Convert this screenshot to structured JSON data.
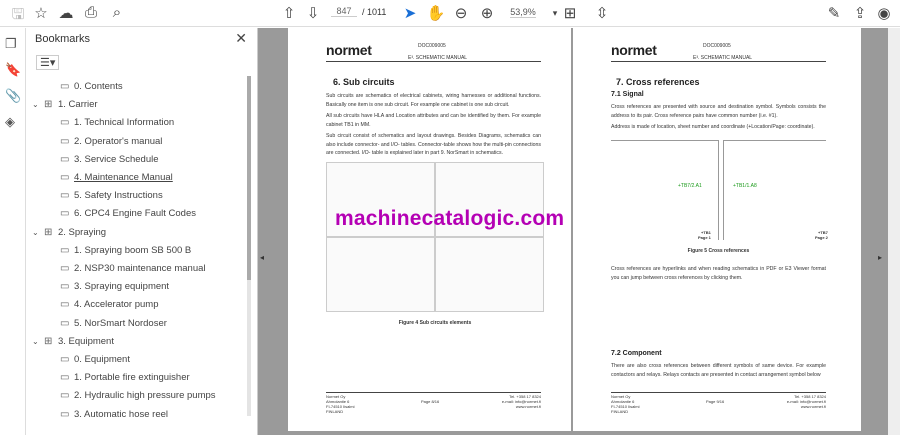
{
  "toolbar": {
    "page_current": "847",
    "page_total": "/ 1011",
    "zoom": "53,9%"
  },
  "bookmarks": {
    "title": "Bookmarks",
    "items": [
      {
        "label": "0. Contents",
        "level": 1,
        "expandable": false
      },
      {
        "label": "1. Carrier",
        "level": 0,
        "expandable": true
      },
      {
        "label": "1. Technical Information",
        "level": 1
      },
      {
        "label": "2. Operator's manual",
        "level": 1
      },
      {
        "label": "3. Service Schedule",
        "level": 1
      },
      {
        "label": "4. Maintenance Manual",
        "level": 1
      },
      {
        "label": "5. Safety Instructions",
        "level": 1
      },
      {
        "label": "6. CPC4 Engine Fault Codes",
        "level": 1
      },
      {
        "label": "2. Spraying",
        "level": 0,
        "expandable": true
      },
      {
        "label": "1. Spraying boom SB 500 B",
        "level": 1
      },
      {
        "label": "2. NSP30 maintenance manual",
        "level": 1
      },
      {
        "label": "3. Spraying equipment",
        "level": 1
      },
      {
        "label": "4. Accelerator pump",
        "level": 1
      },
      {
        "label": "5. NorSmart Nordoser",
        "level": 1
      },
      {
        "label": "3. Equipment",
        "level": 0,
        "expandable": true
      },
      {
        "label": "0. Equipment",
        "level": 1
      },
      {
        "label": "1. Portable fire extinguisher",
        "level": 1
      },
      {
        "label": "2. Hydraulic high pressure pumps",
        "level": 1
      },
      {
        "label": "3. Automatic hose reel",
        "level": 1
      }
    ]
  },
  "page_left": {
    "logo": "normet",
    "doc": "DOC009005",
    "manual": "E³. SCHEMATIC MANUAL",
    "heading": "6.  Sub circuits",
    "p1": "Sub circuits are schematics of electrical cabinets, wiring harnesses or additional functions. Basically one item is one sub circuit. For example one cabinet is one sub circuit.",
    "p2": "All sub circuits have HLA and Location attributes and can be identified by them. For example cabinet TB1 in MM.",
    "p3": "Sub circuit consist of schematics and layout drawings. Besides Diagrams, schematics can also include connector- and I/O- tables. Connector-table shows how the multi-pin connections are connected. I/O- table is explained later in part 9. NorSmart in schematics.",
    "caption": "Figure 4 Sub circuits elements",
    "page": "Page 8/16"
  },
  "page_right": {
    "logo": "normet",
    "doc": "DOC009005",
    "manual": "E³. SCHEMATIC MANUAL",
    "heading": "7.  Cross references",
    "sub1": "7.1   Signal",
    "p1": "Cross references are presented with source and destination symbol. Symbols consists the address to its pair. Cross reference pairs have common number (i.e. #1).",
    "p2": "Address is made of location, sheet number and coordinate (+Location/Page: coordinate).",
    "ref1": "+TB7/2.A1",
    "ref2": "+TB1/1.A8",
    "tb1": "+TB1",
    "pg1": "Page 1",
    "tb2": "+TB7",
    "pg2": "Page 2",
    "caption": "Figure 5 Cross references",
    "p3": "Cross references are hyperlinks and when reading schematics in PDF or E3 Viewer format you can jump between cross references by clicking them.",
    "sub2": "7.2   Component",
    "p4": "There are also cross references between different symbols of same device. For example contactors and relays. Relays contacts are presented in contact arrangement symbol below",
    "page": "Page 9/16"
  },
  "footer": {
    "company": "Normet Oy",
    "address": "Ahmolantie 6",
    "postal": "FI-74510 Iisalmi",
    "country": "FINLAND",
    "tel": "Tel. +358 17 8324",
    "email": "e-mail: info@normet.fi",
    "web": "www.normet.fi"
  },
  "watermark": "machinecatalogic.com"
}
